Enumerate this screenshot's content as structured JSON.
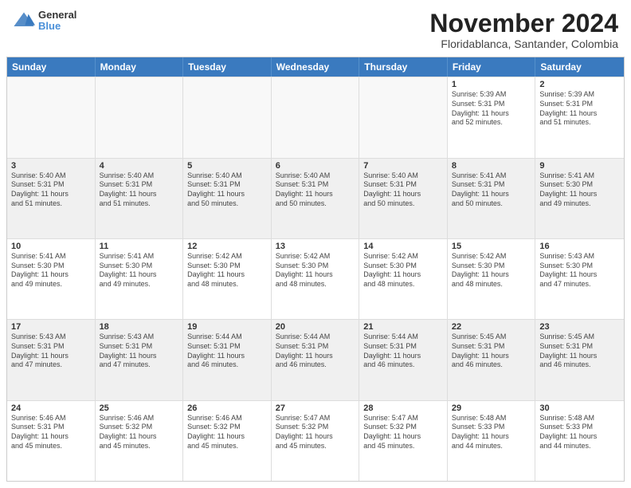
{
  "header": {
    "logo": {
      "general": "General",
      "blue": "Blue"
    },
    "month_title": "November 2024",
    "location": "Floridablanca, Santander, Colombia"
  },
  "weekdays": [
    "Sunday",
    "Monday",
    "Tuesday",
    "Wednesday",
    "Thursday",
    "Friday",
    "Saturday"
  ],
  "weeks": [
    [
      {
        "day": "",
        "info": "",
        "empty": true
      },
      {
        "day": "",
        "info": "",
        "empty": true
      },
      {
        "day": "",
        "info": "",
        "empty": true
      },
      {
        "day": "",
        "info": "",
        "empty": true
      },
      {
        "day": "",
        "info": "",
        "empty": true
      },
      {
        "day": "1",
        "info": "Sunrise: 5:39 AM\nSunset: 5:31 PM\nDaylight: 11 hours\nand 52 minutes."
      },
      {
        "day": "2",
        "info": "Sunrise: 5:39 AM\nSunset: 5:31 PM\nDaylight: 11 hours\nand 51 minutes."
      }
    ],
    [
      {
        "day": "3",
        "info": "Sunrise: 5:40 AM\nSunset: 5:31 PM\nDaylight: 11 hours\nand 51 minutes."
      },
      {
        "day": "4",
        "info": "Sunrise: 5:40 AM\nSunset: 5:31 PM\nDaylight: 11 hours\nand 51 minutes."
      },
      {
        "day": "5",
        "info": "Sunrise: 5:40 AM\nSunset: 5:31 PM\nDaylight: 11 hours\nand 50 minutes."
      },
      {
        "day": "6",
        "info": "Sunrise: 5:40 AM\nSunset: 5:31 PM\nDaylight: 11 hours\nand 50 minutes."
      },
      {
        "day": "7",
        "info": "Sunrise: 5:40 AM\nSunset: 5:31 PM\nDaylight: 11 hours\nand 50 minutes."
      },
      {
        "day": "8",
        "info": "Sunrise: 5:41 AM\nSunset: 5:31 PM\nDaylight: 11 hours\nand 50 minutes."
      },
      {
        "day": "9",
        "info": "Sunrise: 5:41 AM\nSunset: 5:30 PM\nDaylight: 11 hours\nand 49 minutes."
      }
    ],
    [
      {
        "day": "10",
        "info": "Sunrise: 5:41 AM\nSunset: 5:30 PM\nDaylight: 11 hours\nand 49 minutes."
      },
      {
        "day": "11",
        "info": "Sunrise: 5:41 AM\nSunset: 5:30 PM\nDaylight: 11 hours\nand 49 minutes."
      },
      {
        "day": "12",
        "info": "Sunrise: 5:42 AM\nSunset: 5:30 PM\nDaylight: 11 hours\nand 48 minutes."
      },
      {
        "day": "13",
        "info": "Sunrise: 5:42 AM\nSunset: 5:30 PM\nDaylight: 11 hours\nand 48 minutes."
      },
      {
        "day": "14",
        "info": "Sunrise: 5:42 AM\nSunset: 5:30 PM\nDaylight: 11 hours\nand 48 minutes."
      },
      {
        "day": "15",
        "info": "Sunrise: 5:42 AM\nSunset: 5:30 PM\nDaylight: 11 hours\nand 48 minutes."
      },
      {
        "day": "16",
        "info": "Sunrise: 5:43 AM\nSunset: 5:30 PM\nDaylight: 11 hours\nand 47 minutes."
      }
    ],
    [
      {
        "day": "17",
        "info": "Sunrise: 5:43 AM\nSunset: 5:31 PM\nDaylight: 11 hours\nand 47 minutes."
      },
      {
        "day": "18",
        "info": "Sunrise: 5:43 AM\nSunset: 5:31 PM\nDaylight: 11 hours\nand 47 minutes."
      },
      {
        "day": "19",
        "info": "Sunrise: 5:44 AM\nSunset: 5:31 PM\nDaylight: 11 hours\nand 46 minutes."
      },
      {
        "day": "20",
        "info": "Sunrise: 5:44 AM\nSunset: 5:31 PM\nDaylight: 11 hours\nand 46 minutes."
      },
      {
        "day": "21",
        "info": "Sunrise: 5:44 AM\nSunset: 5:31 PM\nDaylight: 11 hours\nand 46 minutes."
      },
      {
        "day": "22",
        "info": "Sunrise: 5:45 AM\nSunset: 5:31 PM\nDaylight: 11 hours\nand 46 minutes."
      },
      {
        "day": "23",
        "info": "Sunrise: 5:45 AM\nSunset: 5:31 PM\nDaylight: 11 hours\nand 46 minutes."
      }
    ],
    [
      {
        "day": "24",
        "info": "Sunrise: 5:46 AM\nSunset: 5:31 PM\nDaylight: 11 hours\nand 45 minutes."
      },
      {
        "day": "25",
        "info": "Sunrise: 5:46 AM\nSunset: 5:32 PM\nDaylight: 11 hours\nand 45 minutes."
      },
      {
        "day": "26",
        "info": "Sunrise: 5:46 AM\nSunset: 5:32 PM\nDaylight: 11 hours\nand 45 minutes."
      },
      {
        "day": "27",
        "info": "Sunrise: 5:47 AM\nSunset: 5:32 PM\nDaylight: 11 hours\nand 45 minutes."
      },
      {
        "day": "28",
        "info": "Sunrise: 5:47 AM\nSunset: 5:32 PM\nDaylight: 11 hours\nand 45 minutes."
      },
      {
        "day": "29",
        "info": "Sunrise: 5:48 AM\nSunset: 5:33 PM\nDaylight: 11 hours\nand 44 minutes."
      },
      {
        "day": "30",
        "info": "Sunrise: 5:48 AM\nSunset: 5:33 PM\nDaylight: 11 hours\nand 44 minutes."
      }
    ]
  ]
}
